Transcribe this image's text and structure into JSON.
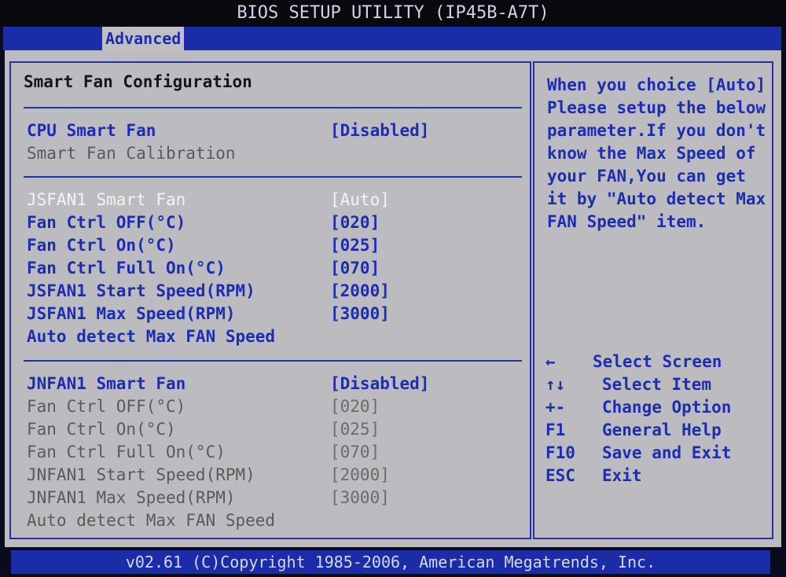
{
  "window_title": "BIOS SETUP UTILITY (IP45B-A7T)",
  "menu": {
    "active_tab": "Advanced"
  },
  "section": {
    "title": "Smart Fan Configuration"
  },
  "cpu": {
    "smart_fan_label": "CPU Smart Fan",
    "smart_fan_value": "[Disabled]",
    "calibration_label": "Smart Fan Calibration"
  },
  "jsfan": {
    "smart_fan_label": "JSFAN1 Smart Fan",
    "smart_fan_value": "[Auto]",
    "off_label": "Fan Ctrl OFF(°C)",
    "off_value": "[020]",
    "on_label": "Fan Ctrl On(°C)",
    "on_value": "[025]",
    "full_label": "Fan Ctrl Full On(°C)",
    "full_value": "[070]",
    "start_label": "JSFAN1 Start Speed(RPM)",
    "start_value": "[2000]",
    "max_label": "JSFAN1 Max Speed(RPM)",
    "max_value": "[3000]",
    "autodetect_label": "Auto detect Max FAN Speed"
  },
  "jnfan": {
    "smart_fan_label": "JNFAN1 Smart Fan",
    "smart_fan_value": "[Disabled]",
    "off_label": "Fan Ctrl OFF(°C)",
    "off_value": "[020]",
    "on_label": "Fan Ctrl On(°C)",
    "on_value": "[025]",
    "full_label": "Fan Ctrl Full On(°C)",
    "full_value": "[070]",
    "start_label": "JNFAN1 Start Speed(RPM)",
    "start_value": "[2000]",
    "max_label": "JNFAN1 Max Speed(RPM)",
    "max_value": "[3000]",
    "autodetect_label": "Auto detect Max FAN Speed"
  },
  "help": {
    "text": "When you choice [Auto]\nPlease setup the below\nparameter.If you don't\nknow the Max Speed of\nyour FAN,You can get\nit by \"Auto detect Max\nFAN Speed\" item."
  },
  "keys": [
    {
      "key": "←",
      "desc": "Select Screen"
    },
    {
      "key": "↑↓",
      "desc": "Select Item"
    },
    {
      "key": "+-",
      "desc": "Change Option"
    },
    {
      "key": "F1",
      "desc": "General Help"
    },
    {
      "key": "F10",
      "desc": "Save and Exit"
    },
    {
      "key": "ESC",
      "desc": "Exit"
    }
  ],
  "footer": {
    "text": "v02.61 (C)Copyright 1985-2006, American Megatrends, Inc."
  },
  "colors": {
    "bios_blue": "#1a2ca8",
    "panel_gray": "#bcbcc0",
    "selected_text": "#f4f4f4",
    "option_blue": "#1c2db2"
  }
}
